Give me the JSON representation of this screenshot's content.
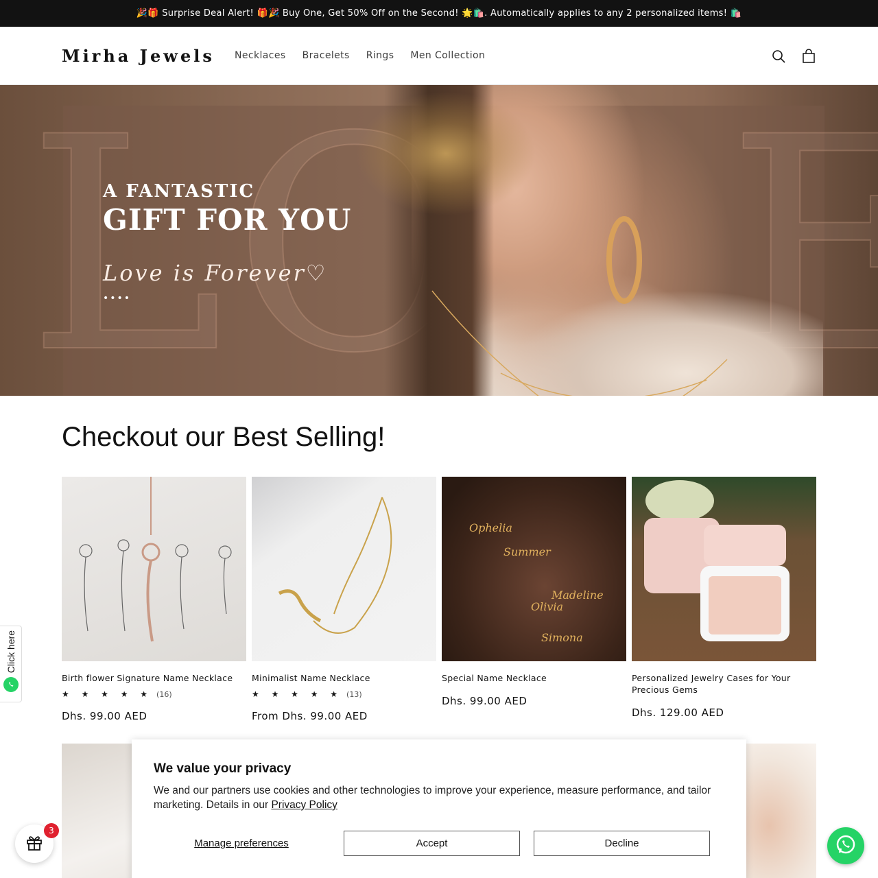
{
  "announcement": "🎉🎁 Surprise Deal Alert! 🎁🎉 Buy One, Get 50% Off on the Second! 🌟🛍️. Automatically applies to any 2 personalized items! 🛍️",
  "header": {
    "logo": "Mirha Jewels",
    "nav": [
      "Necklaces",
      "Bracelets",
      "Rings",
      "Men Collection"
    ],
    "icons": {
      "search": "search-icon",
      "cart": "cart-icon"
    }
  },
  "hero": {
    "line1": "A FANTASTIC",
    "line2": "GIFT FOR YOU",
    "line3": "Love is Forever♡",
    "dots": "••••"
  },
  "best_selling": {
    "title": "Checkout our Best Selling!",
    "products": [
      {
        "name": "Birth flower Signature Name Necklace",
        "stars": "★ ★ ★ ★ ★",
        "rating_count": "(16)",
        "price": "Dhs. 99.00 AED"
      },
      {
        "name": "Minimalist Name Necklace",
        "stars": "★ ★ ★ ★ ★",
        "rating_count": "(13)",
        "price": "From Dhs. 99.00 AED"
      },
      {
        "name": "Special Name Necklace",
        "stars": "",
        "rating_count": "",
        "price": "Dhs. 99.00 AED"
      },
      {
        "name": "Personalized Jewelry Cases for Your Precious Gems",
        "stars": "",
        "rating_count": "",
        "price": "Dhs. 129.00 AED"
      }
    ]
  },
  "privacy": {
    "title": "We value your privacy",
    "text": "We and our partners use cookies and other technologies to improve your experience, measure performance, and tailor marketing. Details in our ",
    "link": "Privacy Policy",
    "manage": "Manage preferences",
    "accept": "Accept",
    "decline": "Decline"
  },
  "side_tab": {
    "label": "Click here"
  },
  "gift_badge": "3",
  "colors": {
    "announcement_bg": "#121212",
    "whatsapp": "#25d366",
    "badge": "#e0212f"
  }
}
